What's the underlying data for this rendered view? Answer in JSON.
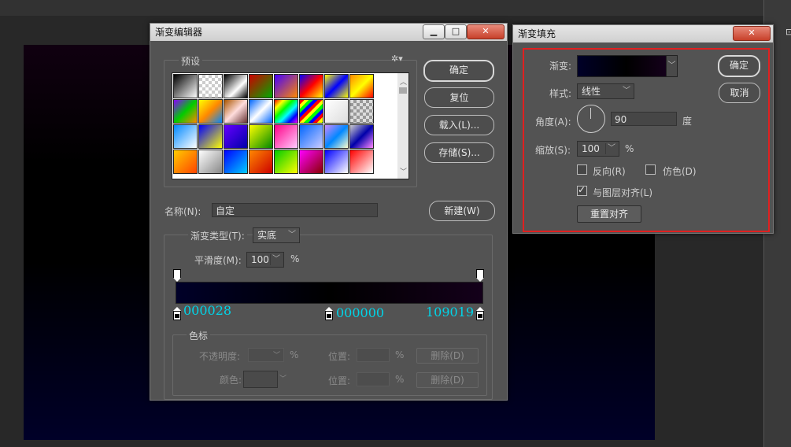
{
  "gradient_editor": {
    "title": "渐变编辑器",
    "presets_label": "预设",
    "ok": "确定",
    "reset": "复位",
    "load": "载入(L)...",
    "save": "存储(S)...",
    "name_label": "名称(N):",
    "name_value": "自定",
    "new": "新建(W)",
    "type_label": "渐变类型(T):",
    "type_value": "实底",
    "smooth_label": "平滑度(M):",
    "smooth_value": "100",
    "percent": "%",
    "color_labels": [
      "000028",
      "000000",
      "109019"
    ],
    "stops_label": "色标",
    "opacity_label": "不透明度:",
    "location_label": "位置:",
    "delete_label": "删除(D)",
    "color_label": "颜色:",
    "colors": {
      "start": "#000028",
      "mid": "#000000",
      "end": "#109019"
    }
  },
  "gradient_fill": {
    "title": "渐变填充",
    "gradient_label": "渐变:",
    "ok": "确定",
    "cancel": "取消",
    "style_label": "样式:",
    "style_value": "线性",
    "angle_label": "角度(A):",
    "angle_value": "90",
    "degree_unit": "度",
    "scale_label": "缩放(S):",
    "scale_value": "100",
    "percent": "%",
    "reverse_label": "反向(R)",
    "reverse_checked": false,
    "dither_label": "仿色(D)",
    "dither_checked": false,
    "align_label": "与图层对齐(L)",
    "align_checked": true,
    "reset_align": "重置对齐",
    "highlight_color": "#e02020"
  },
  "window_icons": [
    "minimize-icon",
    "maximize-icon",
    "close-icon"
  ]
}
